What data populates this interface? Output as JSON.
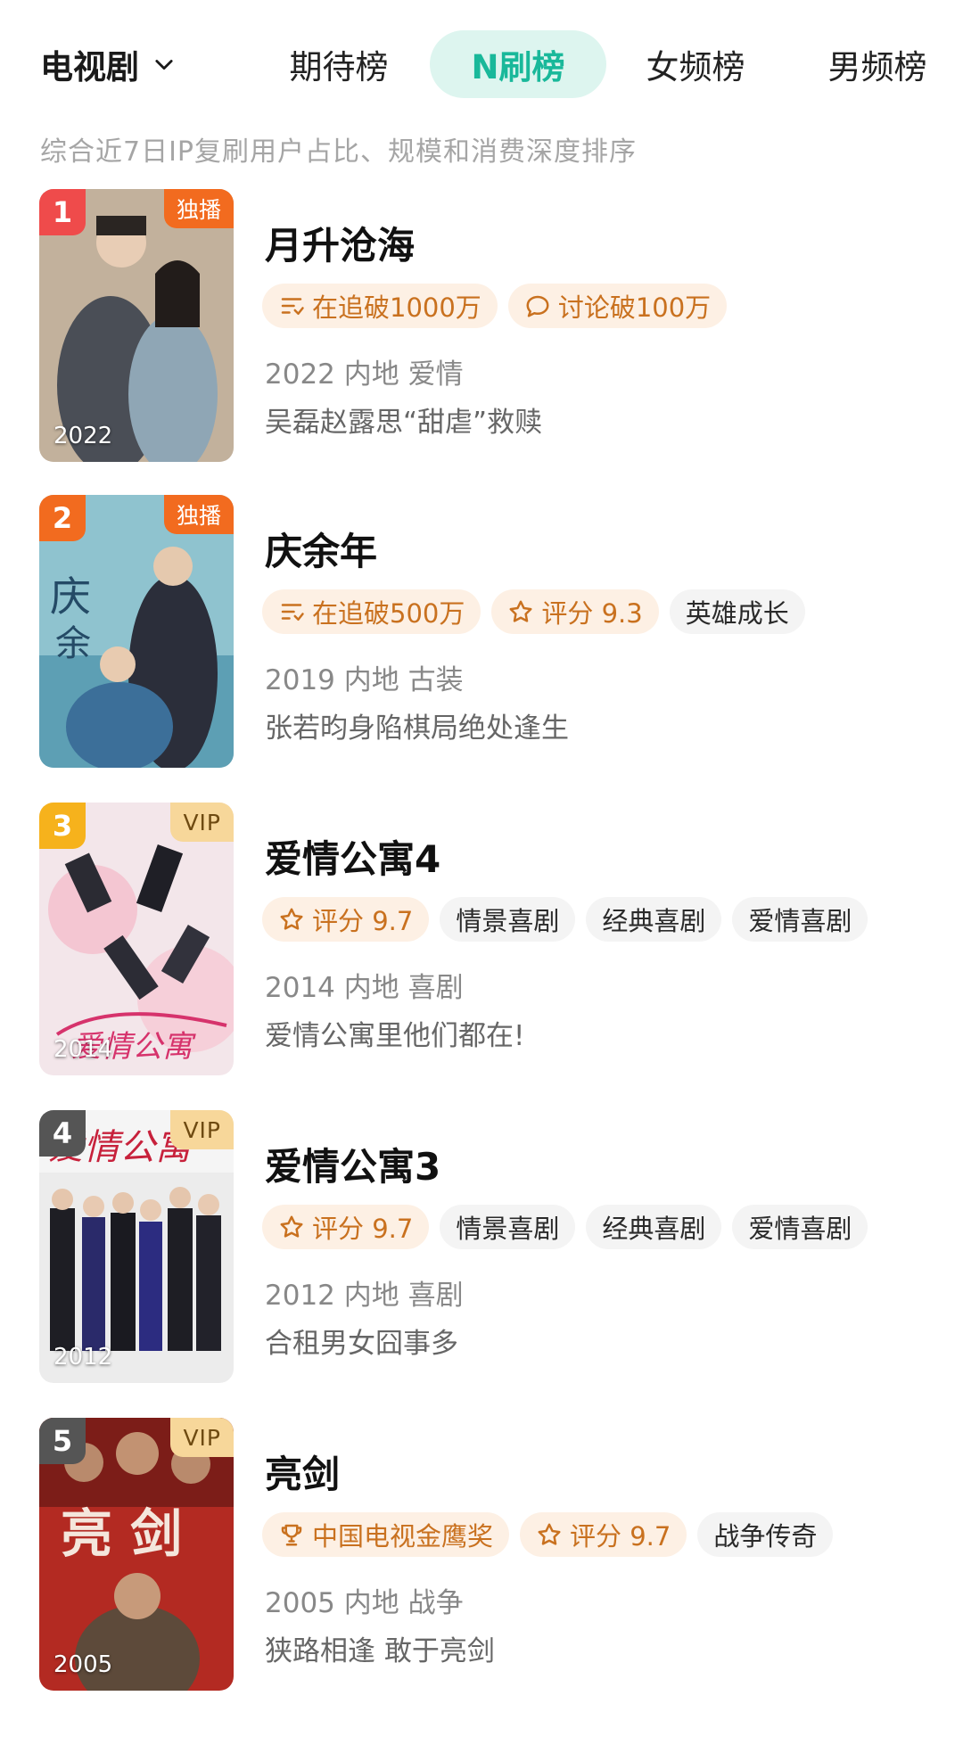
{
  "header": {
    "category": "电视剧",
    "tabs": [
      "期待榜",
      "N刷榜",
      "女频榜",
      "男频榜"
    ],
    "active_tab": "N刷榜"
  },
  "subtitle": "综合近7日IP复刷用户占比、规模和消费深度排序",
  "colors": {
    "accent": "#19b89a",
    "active_tab_bg": "#ddf5ef",
    "rank_1": "#ef4b4b",
    "rank_2": "#f26b1f",
    "rank_3": "#f6b21c",
    "rank_other": "#555555",
    "exclusive_badge": "#f26b1f",
    "vip_badge": "#f7d79a"
  },
  "items": [
    {
      "rank": "1",
      "badge": "独播",
      "poster_year": "2022",
      "title": "月升沧海",
      "tags": [
        {
          "icon": "list-icon",
          "text": "在追破1000万"
        },
        {
          "icon": "comment-icon",
          "text": "讨论破100万"
        }
      ],
      "meta": "2022 内地 爱情",
      "desc": "吴磊赵露思“甜虐”救赎"
    },
    {
      "rank": "2",
      "badge": "独播",
      "poster_year": "",
      "title": "庆余年",
      "tags": [
        {
          "icon": "list-icon",
          "text": "在追破500万"
        },
        {
          "icon": "star-icon",
          "text": "评分 9.3"
        },
        {
          "icon": "",
          "text": "英雄成长"
        }
      ],
      "meta": "2019 内地 古装",
      "desc": "张若昀身陷棋局绝处逢生"
    },
    {
      "rank": "3",
      "badge": "VIP",
      "poster_year": "2014",
      "title": "爱情公寓4",
      "tags": [
        {
          "icon": "star-icon",
          "text": "评分 9.7"
        },
        {
          "icon": "",
          "text": "情景喜剧"
        },
        {
          "icon": "",
          "text": "经典喜剧"
        },
        {
          "icon": "",
          "text": "爱情喜剧"
        }
      ],
      "meta": "2014 内地 喜剧",
      "desc": "爱情公寓里他们都在!"
    },
    {
      "rank": "4",
      "badge": "VIP",
      "poster_year": "2012",
      "title": "爱情公寓3",
      "tags": [
        {
          "icon": "star-icon",
          "text": "评分 9.7"
        },
        {
          "icon": "",
          "text": "情景喜剧"
        },
        {
          "icon": "",
          "text": "经典喜剧"
        },
        {
          "icon": "",
          "text": "爱情喜剧"
        }
      ],
      "meta": "2012 内地 喜剧",
      "desc": "合租男女囧事多"
    },
    {
      "rank": "5",
      "badge": "VIP",
      "poster_year": "2005",
      "title": "亮剑",
      "tags": [
        {
          "icon": "trophy-icon",
          "text": "中国电视金鹰奖"
        },
        {
          "icon": "star-icon",
          "text": "评分 9.7"
        },
        {
          "icon": "",
          "text": "战争传奇"
        }
      ],
      "meta": "2005 内地 战争",
      "desc": "狭路相逢 敢于亮剑"
    }
  ]
}
